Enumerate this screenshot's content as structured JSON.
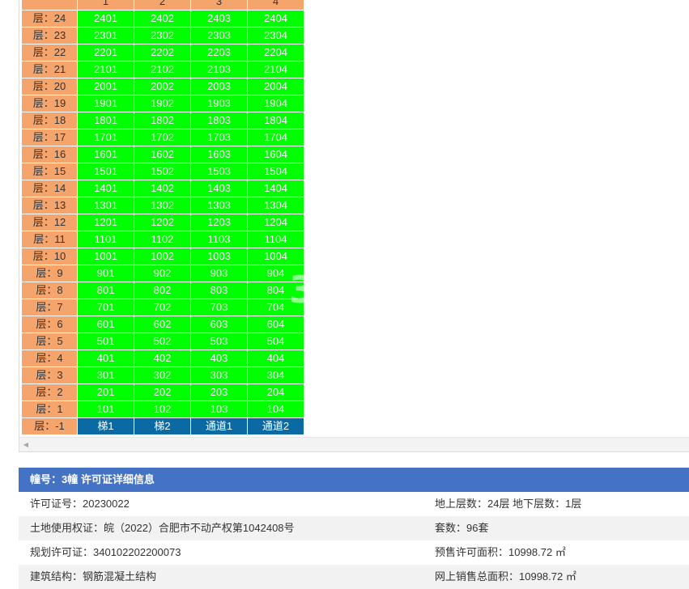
{
  "grid": {
    "columns": [
      "1",
      "2",
      "3",
      "4"
    ],
    "rows": [
      {
        "floor": "层：24",
        "units": [
          "2401",
          "2402",
          "2403",
          "2404"
        ]
      },
      {
        "floor": "层：23",
        "units": [
          "2301",
          "2302",
          "2303",
          "2304"
        ]
      },
      {
        "floor": "层：22",
        "units": [
          "2201",
          "2202",
          "2203",
          "2204"
        ]
      },
      {
        "floor": "层：21",
        "units": [
          "2101",
          "2102",
          "2103",
          "2104"
        ]
      },
      {
        "floor": "层：20",
        "units": [
          "2001",
          "2002",
          "2003",
          "2004"
        ]
      },
      {
        "floor": "层：19",
        "units": [
          "1901",
          "1902",
          "1903",
          "1904"
        ]
      },
      {
        "floor": "层：18",
        "units": [
          "1801",
          "1802",
          "1803",
          "1804"
        ]
      },
      {
        "floor": "层：17",
        "units": [
          "1701",
          "1702",
          "1703",
          "1704"
        ]
      },
      {
        "floor": "层：16",
        "units": [
          "1601",
          "1602",
          "1603",
          "1604"
        ]
      },
      {
        "floor": "层：15",
        "units": [
          "1501",
          "1502",
          "1503",
          "1504"
        ]
      },
      {
        "floor": "层：14",
        "units": [
          "1401",
          "1402",
          "1403",
          "1404"
        ]
      },
      {
        "floor": "层：13",
        "units": [
          "1301",
          "1302",
          "1303",
          "1304"
        ]
      },
      {
        "floor": "层：12",
        "units": [
          "1201",
          "1202",
          "1203",
          "1204"
        ]
      },
      {
        "floor": "层：11",
        "units": [
          "1101",
          "1102",
          "1103",
          "1104"
        ]
      },
      {
        "floor": "层：10",
        "units": [
          "1001",
          "1002",
          "1003",
          "1004"
        ]
      },
      {
        "floor": "层：9",
        "units": [
          "901",
          "902",
          "903",
          "904"
        ]
      },
      {
        "floor": "层：8",
        "units": [
          "801",
          "802",
          "803",
          "804"
        ]
      },
      {
        "floor": "层：7",
        "units": [
          "701",
          "702",
          "703",
          "704"
        ]
      },
      {
        "floor": "层：6",
        "units": [
          "601",
          "602",
          "603",
          "604"
        ]
      },
      {
        "floor": "层：5",
        "units": [
          "501",
          "502",
          "503",
          "504"
        ]
      },
      {
        "floor": "层：4",
        "units": [
          "401",
          "402",
          "403",
          "404"
        ]
      },
      {
        "floor": "层：3",
        "units": [
          "301",
          "302",
          "303",
          "304"
        ]
      },
      {
        "floor": "层：2",
        "units": [
          "201",
          "202",
          "203",
          "204"
        ]
      },
      {
        "floor": "层：1",
        "units": [
          "101",
          "102",
          "103",
          "104"
        ]
      },
      {
        "floor": "层：-1",
        "units": [
          "梯1",
          "梯2",
          "通道1",
          "通道2"
        ],
        "special": true
      }
    ],
    "colors": {
      "floor": "#f5a46c",
      "available": "#00ff00",
      "special": "#0b6aa3"
    },
    "watermark": "36",
    "scroll_left_icon": "triangle-left-icon"
  },
  "info": {
    "title": "幢号：3幢 许可证详细信息",
    "header_color": "#4472c4",
    "rows": [
      {
        "left": "许可证号：20230022",
        "right": "地上层数：24层  地下层数：1层"
      },
      {
        "left": "土地使用权证：皖（2022）合肥市不动产权第1042408号",
        "right": "套数：96套"
      },
      {
        "left": "规划许可证：340102202200073",
        "right": "预售许可面积：10998.72 ㎡"
      },
      {
        "left": "建筑结构：钢筋混凝土结构",
        "right": "网上销售总面积：10998.72 ㎡"
      }
    ]
  }
}
